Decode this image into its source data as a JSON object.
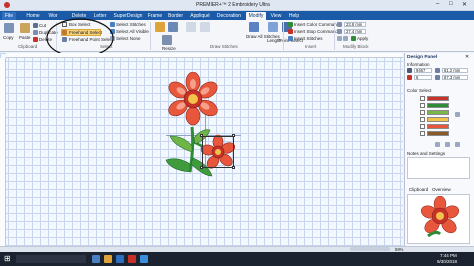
{
  "window": {
    "title": "PREMIER+™ 2 Embroidery Ultra"
  },
  "tabs": [
    "File",
    "Home",
    "Wor",
    "Delete",
    "Letter",
    "SuperDesign",
    "Frame",
    "Border",
    "Appliqué",
    "Decoration",
    "Modify",
    "View",
    "Help"
  ],
  "ribbon": {
    "clipboard": {
      "copy": "Copy",
      "paste": "Paste",
      "cut": "Cut",
      "duplicate": "Duplicate",
      "delete": "Delete",
      "group": "Clipboard"
    },
    "select": {
      "box": "Box Select",
      "freehand": "Freehand Select",
      "freehand_point": "Freehand Point Select",
      "stitches": "Select Stitches",
      "all_visible": "Select All Visible",
      "none": "Select None",
      "group": "Select"
    },
    "draw": {
      "resize": "Resize",
      "draw_all": "Draw All Stitches",
      "length": "Length",
      "point_select": "Point Select",
      "group": "Draw Stitches"
    },
    "insert": {
      "color_cmd": "Insert Color Command",
      "stop_cmd": "Insert Stop Command",
      "stitches": "Insert Stitches",
      "group": "Insert",
      "apply": "Apply",
      "field1": "23.8 mm",
      "field2": "27.4 mm"
    },
    "modify_block": {
      "group": "Modify Block"
    }
  },
  "panel": {
    "title": "Design Panel",
    "information": "Information",
    "stitches": "9467",
    "colors": "6",
    "width": "61.2 mm",
    "height": "87.3 mm",
    "color_select": "Color Select",
    "swatches": [
      "#c8302a",
      "#2e8b36",
      "#7ab648",
      "#f2c24a",
      "#e8563b",
      "#8a5a2b"
    ],
    "notes": "Notes and Settings",
    "clipboard_tab": "Clipboard",
    "overview_tab": "Overview"
  },
  "status": {
    "zoom": "59%"
  },
  "taskbar": {
    "time": "7:44 PM",
    "date": "9/30/2018"
  }
}
